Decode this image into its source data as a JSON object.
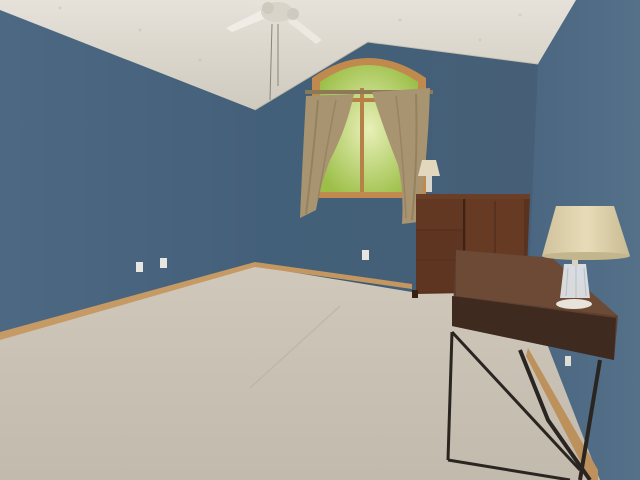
{
  "scene": {
    "description_label": "",
    "colors": {
      "wall_left": "#4a6580",
      "wall_back": "#45607a",
      "wall_right": "#4f6b84",
      "ceiling": "#ddd9d0",
      "carpet": "#c9c2b6",
      "baseboard": "#c59a64",
      "curtain": "#a89470",
      "window_frame": "#c08a4e",
      "foliage": "#9cc24a",
      "dresser": "#5a3320",
      "desk_top": "#5e4030",
      "desk_legs": "#2a2520",
      "lampshade": "#ddd1ad"
    }
  }
}
